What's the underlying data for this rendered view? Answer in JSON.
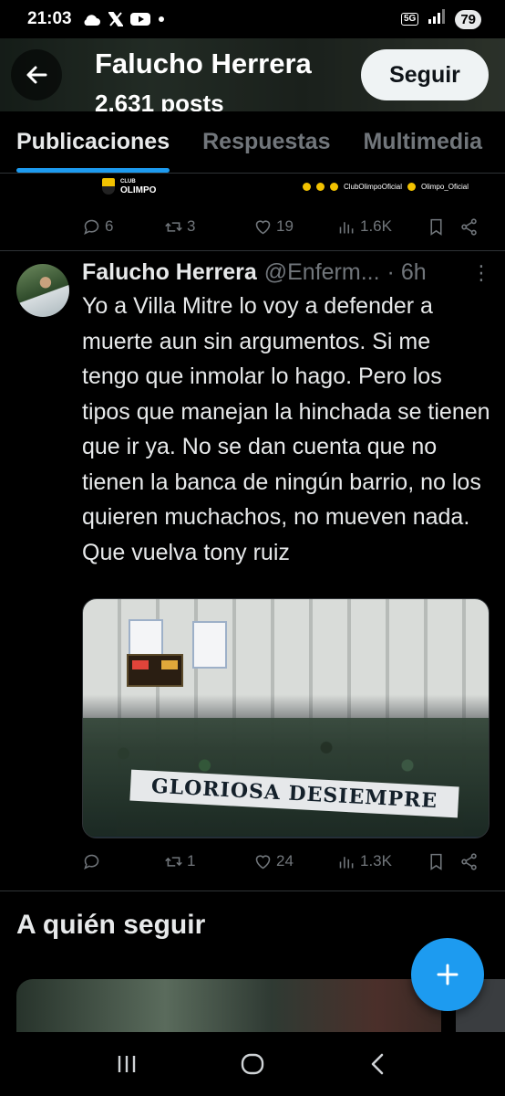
{
  "status_bar": {
    "time": "21:03",
    "network": "5G",
    "battery": "79"
  },
  "header": {
    "title": "Falucho Herrera",
    "posts_count": "2.631 posts",
    "follow_label": "Seguir"
  },
  "tabs": [
    {
      "label": "Publicaciones",
      "active": true
    },
    {
      "label": "Respuestas",
      "active": false
    },
    {
      "label": "Multimedia",
      "active": false
    }
  ],
  "prev_tweet": {
    "media_strip": {
      "logo_top": "CLUB",
      "logo_name": "OLIMPO",
      "social_a": "ClubOlimpoOficial",
      "social_b": "Olimpo_Oficial"
    },
    "replies": "6",
    "reposts": "3",
    "likes": "19",
    "views": "1.6K"
  },
  "tweet": {
    "author_name": "Falucho Herrera",
    "handle": "@Enferm...",
    "time": "· 6h",
    "more": "⋮",
    "text": "Yo a Villa Mitre lo voy a defender a muerte aun sin argumentos. Si me tengo que inmolar lo hago. Pero los tipos que manejan la hinchada se tienen que ir ya. No se dan cuenta que no tienen la banca de ningún barrio, no los quieren muchachos, no mueven nada. Que vuelva tony ruiz",
    "media_banner": "GLORIOSA DESIEMPRE",
    "replies": "",
    "reposts": "1",
    "likes": "24",
    "views": "1.3K"
  },
  "who_to_follow": {
    "title": "A quién seguir"
  },
  "colors": {
    "accent": "#1d9bf0",
    "background": "#000000",
    "text": "#e7e9ea",
    "muted": "#71767b",
    "divider": "#2f3336"
  }
}
